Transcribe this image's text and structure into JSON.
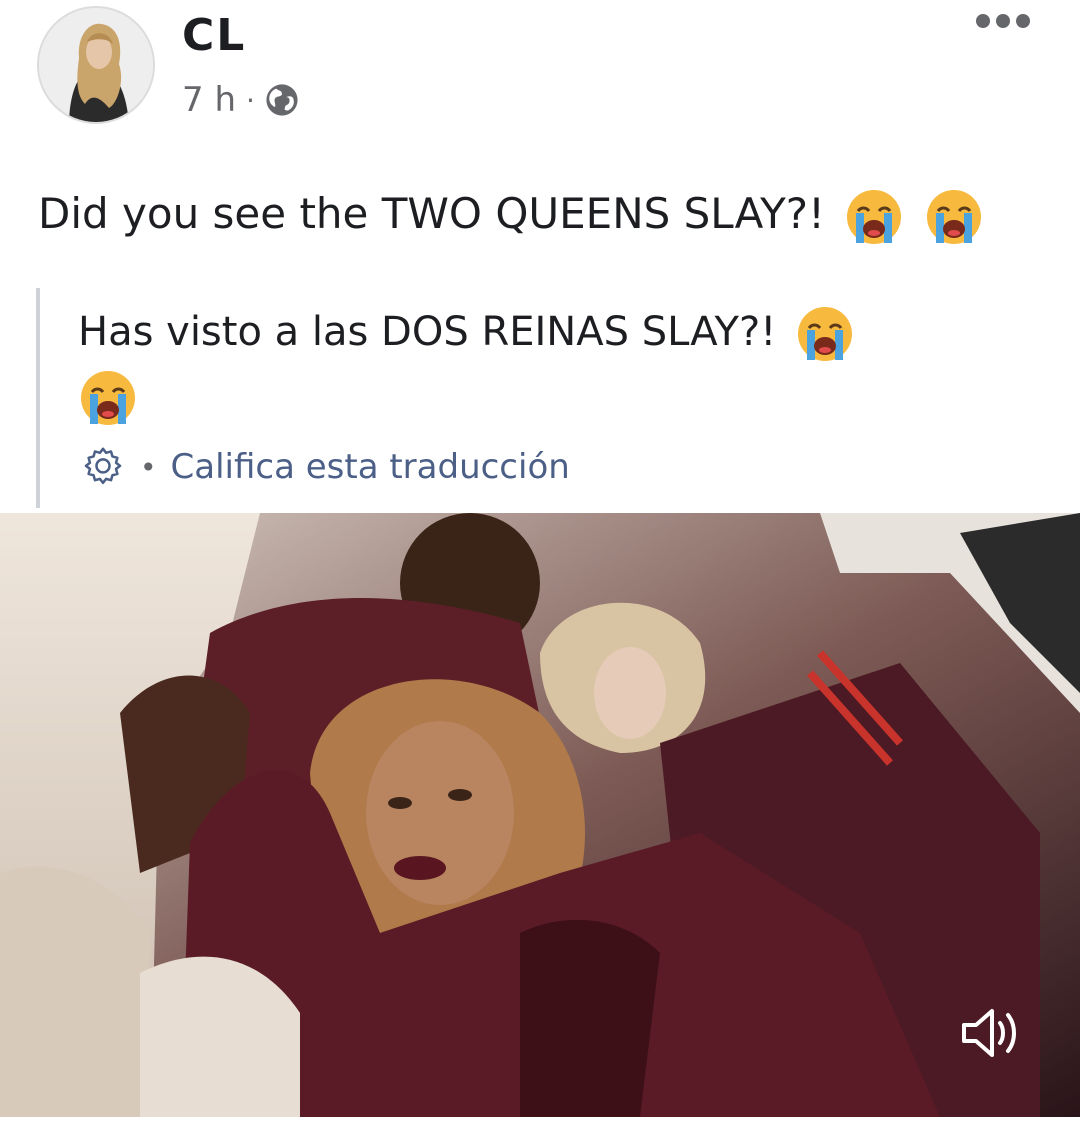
{
  "post": {
    "author": "CL",
    "time": "7 h",
    "separator": "·",
    "text": "Did you see the TWO QUEENS SLAY?!",
    "text_emojis": [
      "loudly-crying-face",
      "loudly-crying-face"
    ]
  },
  "translation": {
    "text": "Has visto a las DOS REINAS SLAY?!",
    "emojis": [
      "loudly-crying-face",
      "loudly-crying-face"
    ],
    "separator": "•",
    "rate_label": "Califica esta traducción"
  },
  "icons": {
    "more": "more-horizontal-icon",
    "audience": "globe-icon",
    "settings": "gear-icon",
    "volume": "volume-icon"
  },
  "colors": {
    "text": "#1c1e21",
    "meta": "#65676b",
    "link": "#4b5f87",
    "quote_bar": "#cfd2d6",
    "emoji_face": "#f7b93e"
  }
}
